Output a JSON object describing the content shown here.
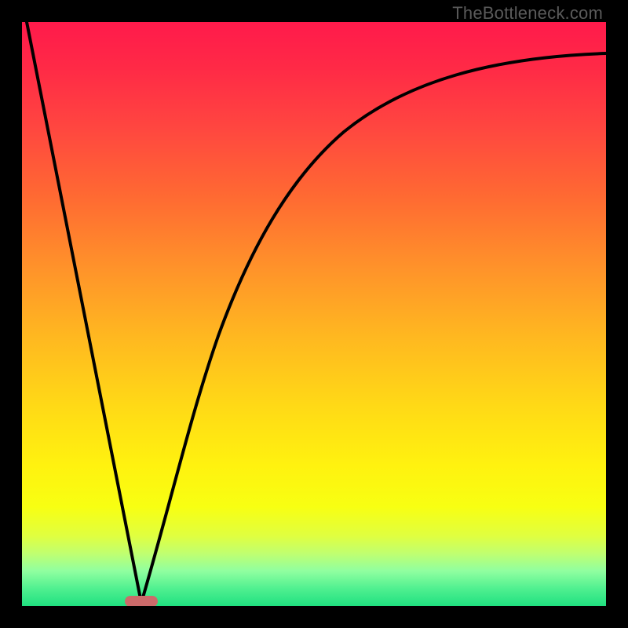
{
  "watermark": "TheBottleneck.com",
  "colors": {
    "frame": "#000000",
    "curve": "#000000",
    "marker": "#cc6a6a",
    "gradient_top": "#ff1a4b",
    "gradient_bottom": "#20e080"
  },
  "chart_data": {
    "type": "line",
    "title": "",
    "xlabel": "",
    "ylabel": "",
    "xlim": [
      0,
      100
    ],
    "ylim": [
      0,
      100
    ],
    "grid": false,
    "legend": false,
    "background": "vertical-gradient red→yellow→green",
    "series": [
      {
        "name": "left-branch",
        "description": "steep descending line from top-left to minimum",
        "x": [
          0,
          5,
          10,
          15,
          18,
          20
        ],
        "y": [
          100,
          75,
          50,
          25,
          8,
          0
        ]
      },
      {
        "name": "right-branch",
        "description": "rising decelerating curve from minimum toward upper right",
        "x": [
          20,
          24,
          28,
          33,
          38,
          44,
          52,
          62,
          75,
          88,
          100
        ],
        "y": [
          0,
          15,
          30,
          45,
          58,
          68,
          77,
          84,
          89,
          92,
          94
        ]
      }
    ],
    "marker": {
      "name": "optimal-point",
      "x": 20,
      "y": 0,
      "shape": "rounded-pill"
    }
  }
}
